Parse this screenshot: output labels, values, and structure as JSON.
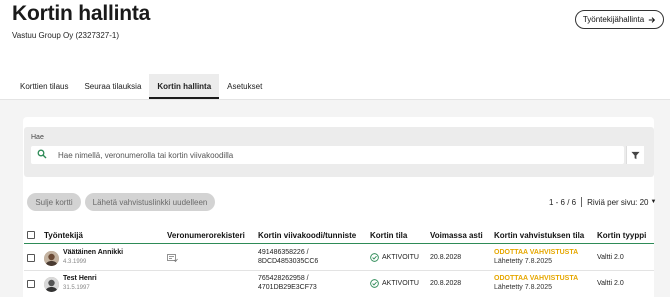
{
  "header": {
    "title": "Kortin hallinta",
    "company": "Vastuu Group Oy (2327327-1)",
    "employee_button": "Työntekijähallinta"
  },
  "tabs": [
    {
      "label": "Korttien tilaus",
      "active": false
    },
    {
      "label": "Seuraa tilauksia",
      "active": false
    },
    {
      "label": "Kortin hallinta",
      "active": true
    },
    {
      "label": "Asetukset",
      "active": false
    }
  ],
  "search": {
    "label": "Hae",
    "placeholder": "Hae nimellä, veronumerolla tai kortin viivakoodilla",
    "value": ""
  },
  "actions": {
    "close_card": "Sulje kortti",
    "resend_link": "Lähetä vahvistuslinkki uudelleen"
  },
  "pagination": {
    "range": "1 - 6 / 6",
    "per_page_label": "Riviä per sivu: 20"
  },
  "table": {
    "headers": [
      "Työntekijä",
      "Veronumerorekisteri",
      "Kortin viivakoodi/tunniste",
      "Kortin tila",
      "Voimassa asti",
      "Kortin vahvistuksen tila",
      "Kortin tyyppi"
    ],
    "rows": [
      {
        "name": "Väätäinen Annikki",
        "dob": "4.3.1999",
        "barcode": "491486358226 /",
        "tag": "8DCD4853035CC6",
        "status": "AKTIVOITU",
        "valid_until": "20.8.2028",
        "verification_state": "ODOTTAA VAHVISTUSTA",
        "sent": "Lähetetty 7.8.2025",
        "card_type": "Valtti 2.0"
      },
      {
        "name": "Test Henri",
        "dob": "31.5.1997",
        "barcode": "765428262958 /",
        "tag": "4701DB29E3CF73",
        "status": "AKTIVOITU",
        "valid_until": "20.8.2028",
        "verification_state": "ODOTTAA VAHVISTUSTA",
        "sent": "Lähetetty 7.8.2025",
        "card_type": "Valtti 2.0"
      }
    ]
  },
  "colors": {
    "accent_green": "#2e8b57",
    "pending_orange": "#e6a700",
    "tab_active_bg": "#ececec"
  },
  "icons": [
    "arrow-right-icon",
    "search-icon",
    "filter-icon",
    "tax-register-icon",
    "check-circle-icon",
    "checkbox-icon"
  ]
}
